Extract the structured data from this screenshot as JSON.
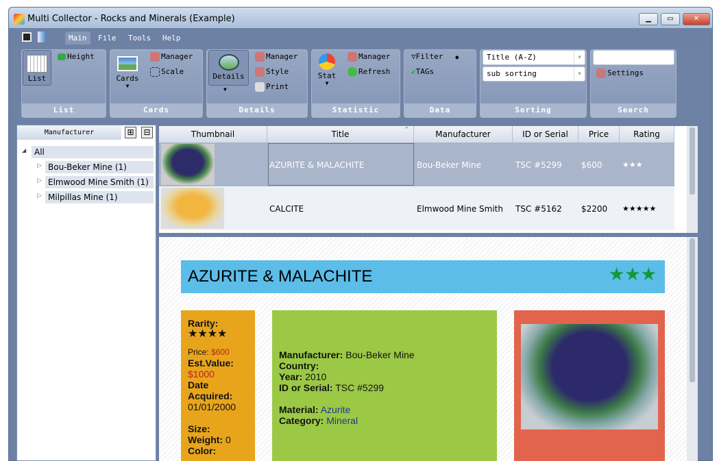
{
  "window": {
    "title": "Multi Collector - Rocks and Minerals (Example)"
  },
  "menu": [
    "Main",
    "File",
    "Tools",
    "Help"
  ],
  "ribbon": {
    "list": {
      "group": "List",
      "list_btn": "List",
      "height": "Height"
    },
    "cards": {
      "group": "Cards",
      "cards_btn": "Cards",
      "manager": "Manager",
      "scale": "Scale"
    },
    "details": {
      "group": "Details",
      "details_btn": "Details",
      "manager": "Manager",
      "style": "Style",
      "print": "Print"
    },
    "statistic": {
      "group": "Statistic",
      "stat_btn": "Stat",
      "manager": "Manager",
      "refresh": "Refresh"
    },
    "data": {
      "group": "Data",
      "filter": "Filter",
      "tags": "TAGs"
    },
    "sorting": {
      "group": "Sorting",
      "primary": "Title (A-Z)",
      "secondary": "sub sorting"
    },
    "search": {
      "group": "Search",
      "value": "",
      "settings": "Settings"
    }
  },
  "left": {
    "header": "Manufacturer",
    "root": "All",
    "items": [
      "Bou-Beker Mine (1)",
      "Elmwood Mine Smith (1)",
      "Milpillas Mine (1)"
    ]
  },
  "grid": {
    "columns": [
      "Thumbnail",
      "Title",
      "Manufacturer",
      "ID or Serial",
      "Price",
      "Rating"
    ],
    "rows": [
      {
        "title": "AZURITE & MALACHITE",
        "manufacturer": "Bou-Beker Mine",
        "id": "TSC #5299",
        "price": "$600",
        "rating": "★★★"
      },
      {
        "title": "CALCITE",
        "manufacturer": "Elmwood Mine Smith",
        "id": "TSC #5162",
        "price": "$2200",
        "rating": "★★★★★"
      }
    ]
  },
  "detail": {
    "title": "AZURITE & MALACHITE",
    "stars": "★★★",
    "rarity_label": "Rarity:",
    "rarity": "★★★★",
    "price_label": "Price:",
    "price": "$600",
    "estvalue_label": "Est.Value:",
    "estvalue": "$1000",
    "date_label": "Date Acquired:",
    "date": "01/01/2000",
    "size_label": "Size:",
    "weight_label": "Weight:",
    "weight": "0",
    "color_label": "Color:",
    "manufacturer_label": "Manufacturer:",
    "manufacturer": "Bou-Beker Mine",
    "country_label": "Country:",
    "year_label": "Year:",
    "year": "2010",
    "id_label": "ID or Serial:",
    "id": "TSC #5299",
    "material_label": "Material:",
    "material": "Azurite",
    "category_label": "Category:",
    "category": "Mineral"
  },
  "colors": {
    "header_bar": "#5bbde8",
    "rarity_box": "#e8a51c",
    "info_box": "#9bc945",
    "image_box": "#e2644c",
    "stars": "#119933"
  }
}
